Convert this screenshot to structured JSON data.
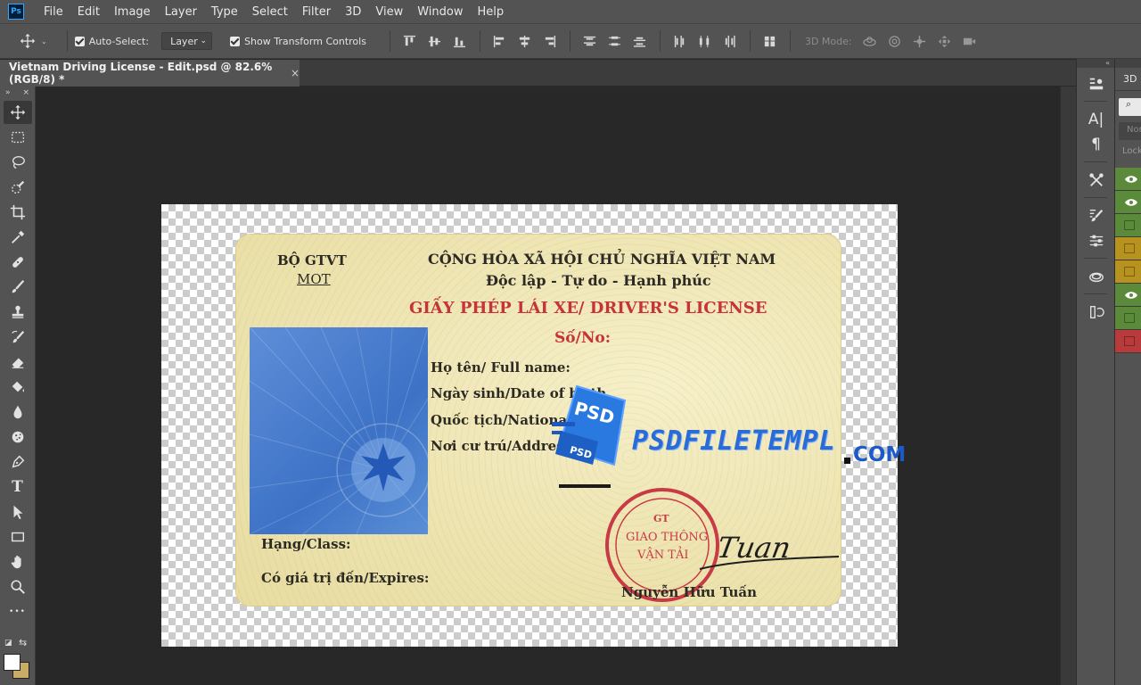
{
  "app": {
    "logo_text": "Ps",
    "brand_color": "#31a8ff"
  },
  "menu": [
    "File",
    "Edit",
    "Image",
    "Layer",
    "Type",
    "Select",
    "Filter",
    "3D",
    "View",
    "Window",
    "Help"
  ],
  "options_bar": {
    "tool_icon": "move-tool-icon",
    "auto_select_label": "Auto-Select:",
    "auto_select_checked": true,
    "auto_select_target": "Layer",
    "show_transform_label": "Show Transform Controls",
    "show_transform_checked": true,
    "three_d_mode_label": "3D Mode:"
  },
  "document_tab": {
    "title": "Vietnam Driving License - Edit.psd @ 82.6% (RGB/8) *",
    "close_glyph": "×"
  },
  "toolbar": {
    "header_left": "»",
    "header_right": "×",
    "tools": [
      "move",
      "marquee",
      "lasso",
      "quick-selection",
      "crop",
      "eyedropper",
      "healing-brush",
      "brush",
      "clone-stamp",
      "history-brush",
      "eraser",
      "paint-bucket",
      "blur",
      "dodge",
      "pen",
      "type",
      "path-selection",
      "rectangle",
      "hand",
      "zoom",
      "more"
    ],
    "type_glyph": "T",
    "more_glyph": "•••",
    "foreground_color": "#ffffff",
    "background_color": "#c9ad66"
  },
  "card": {
    "ministry_vi": "BỘ GTVT",
    "ministry_en": "MOT",
    "republic": "CỘNG HÒA XÃ HỘI CHỦ NGHĨA VIỆT NAM",
    "motto": "Độc lập  - Tự do - Hạnh phúc",
    "title": "GIẤY PHÉP LÁI XE/ DRIVER'S LICENSE",
    "number_label": "Số/No:",
    "fields": {
      "name": "Họ tên/ Full name:",
      "dob": "Ngày sinh/Date of birth",
      "nationality": "Quốc tịch/Nationality",
      "address": "Nơi cư trú/Address:",
      "class": "Hạng/Class:",
      "expires": "Có giá trị đến/Expires:"
    },
    "signer": "Nguyễn Hữu Tuấn",
    "stamp_lines": [
      "GIAO THÔNG",
      "VẬN TẢI"
    ],
    "stamp_top": "GT",
    "signature_text": "Tuan"
  },
  "watermark": {
    "badge_text": "PSD",
    "badge_text_small": "PSD",
    "domain_text": "PSDFILETEMPL",
    "domain_tld": "COM"
  },
  "right_dock": {
    "collapse_glyph": "«",
    "icons": [
      "properties-icon",
      "character-icon",
      "paragraph-icon",
      "tools-preset-icon",
      "brushes-icon",
      "adjustments-icon",
      "libraries-icon",
      "history-icon"
    ]
  },
  "right_panel": {
    "tab_label": "3D",
    "search_glyph": "⌕",
    "mode_label": "Nor",
    "lock_label": "Lock",
    "rows": [
      {
        "color": "#5b8a3a",
        "visible": true
      },
      {
        "color": "#5b8a3a",
        "visible": true
      },
      {
        "color": "#5b8a3a",
        "visible": false
      },
      {
        "color": "#b8921e",
        "visible": false
      },
      {
        "color": "#b8921e",
        "visible": false
      },
      {
        "color": "#5b8a3a",
        "visible": true
      },
      {
        "color": "#5b8a3a",
        "visible": false
      },
      {
        "color": "#b83a3a",
        "visible": false
      }
    ]
  }
}
